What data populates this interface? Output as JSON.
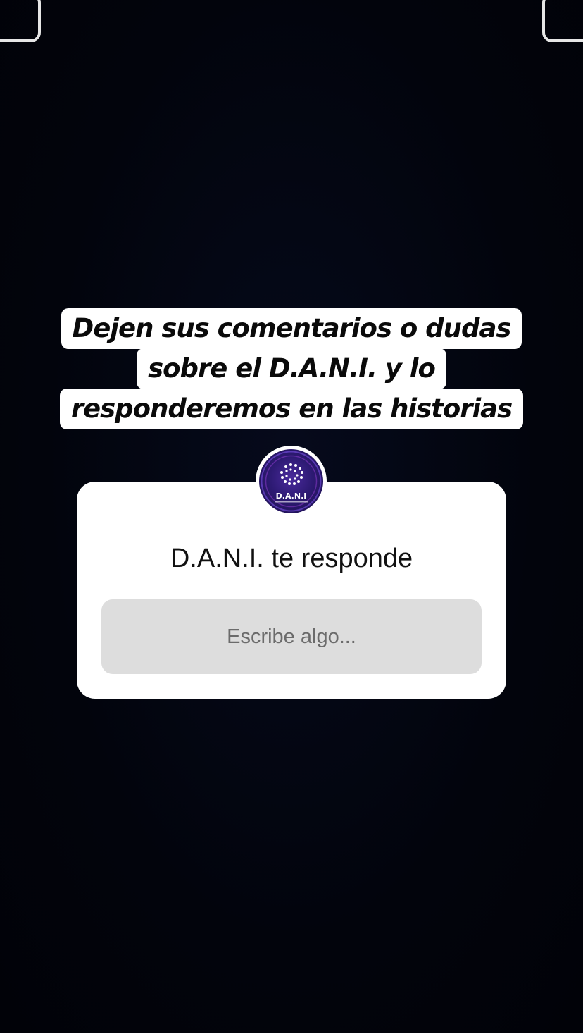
{
  "caption": {
    "lines": [
      "Dejen sus comentarios o dudas",
      "sobre el D.A.N.I. y lo",
      "responderemos en las historias"
    ]
  },
  "question_sticker": {
    "avatar_logo_text": "D.A.N.I",
    "title": "D.A.N.I. te responde",
    "placeholder": "Escribe algo..."
  },
  "colors": {
    "background": "#02050f",
    "sticker": "#ffffff",
    "input": "#dddddd",
    "avatar": "#2d1a73"
  },
  "icons": {
    "avatar": "dani-logo-icon",
    "corners": "frame-corner-icon"
  }
}
